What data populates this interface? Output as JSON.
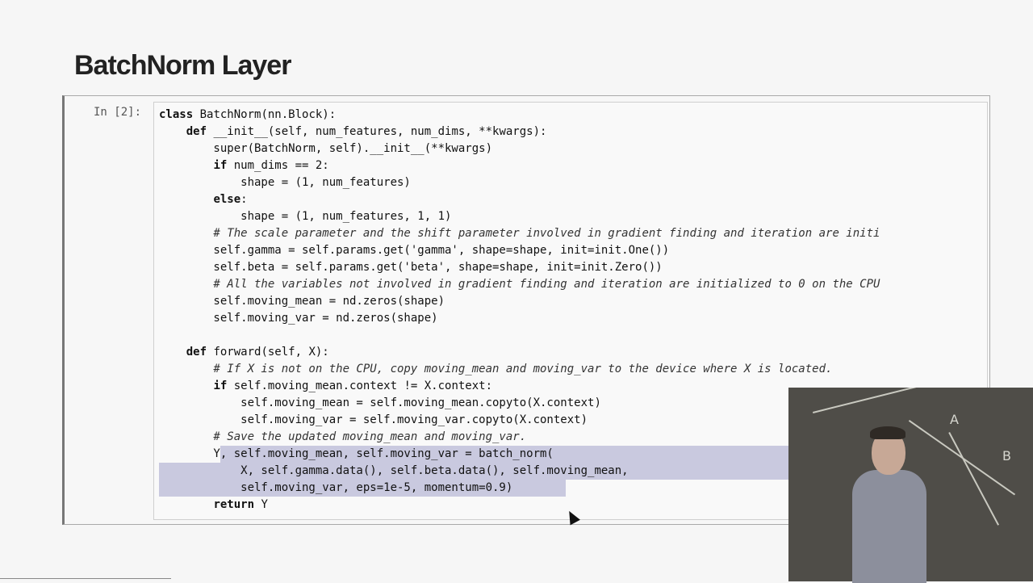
{
  "slide": {
    "title": "BatchNorm Layer"
  },
  "cell": {
    "prompt": "In [2]:",
    "code": [
      "class BatchNorm(nn.Block):",
      "    def __init__(self, num_features, num_dims, **kwargs):",
      "        super(BatchNorm, self).__init__(**kwargs)",
      "        if num_dims == 2:",
      "            shape = (1, num_features)",
      "        else:",
      "            shape = (1, num_features, 1, 1)",
      "        # The scale parameter and the shift parameter involved in gradient finding and iteration are initi",
      "        self.gamma = self.params.get('gamma', shape=shape, init=init.One())",
      "        self.beta = self.params.get('beta', shape=shape, init=init.Zero())",
      "        # All the variables not involved in gradient finding and iteration are initialized to 0 on the CPU",
      "        self.moving_mean = nd.zeros(shape)",
      "        self.moving_var = nd.zeros(shape)",
      "",
      "    def forward(self, X):",
      "        # If X is not on the CPU, copy moving_mean and moving_var to the device where X is located.",
      "        if self.moving_mean.context != X.context:",
      "            self.moving_mean = self.moving_mean.copyto(X.context)",
      "            self.moving_var = self.moving_var.copyto(X.context)",
      "        # Save the updated moving_mean and moving_var.",
      "        Y, self.moving_mean, self.moving_var = batch_norm(",
      "            X, self.gamma.data(), self.beta.data(), self.moving_mean,",
      "            self.moving_var, eps=1e-5, momentum=0.9)",
      "        return Y"
    ],
    "selected_lines": [
      20,
      21,
      22
    ]
  },
  "webcam": {
    "board_letters": [
      "A",
      "B"
    ]
  }
}
